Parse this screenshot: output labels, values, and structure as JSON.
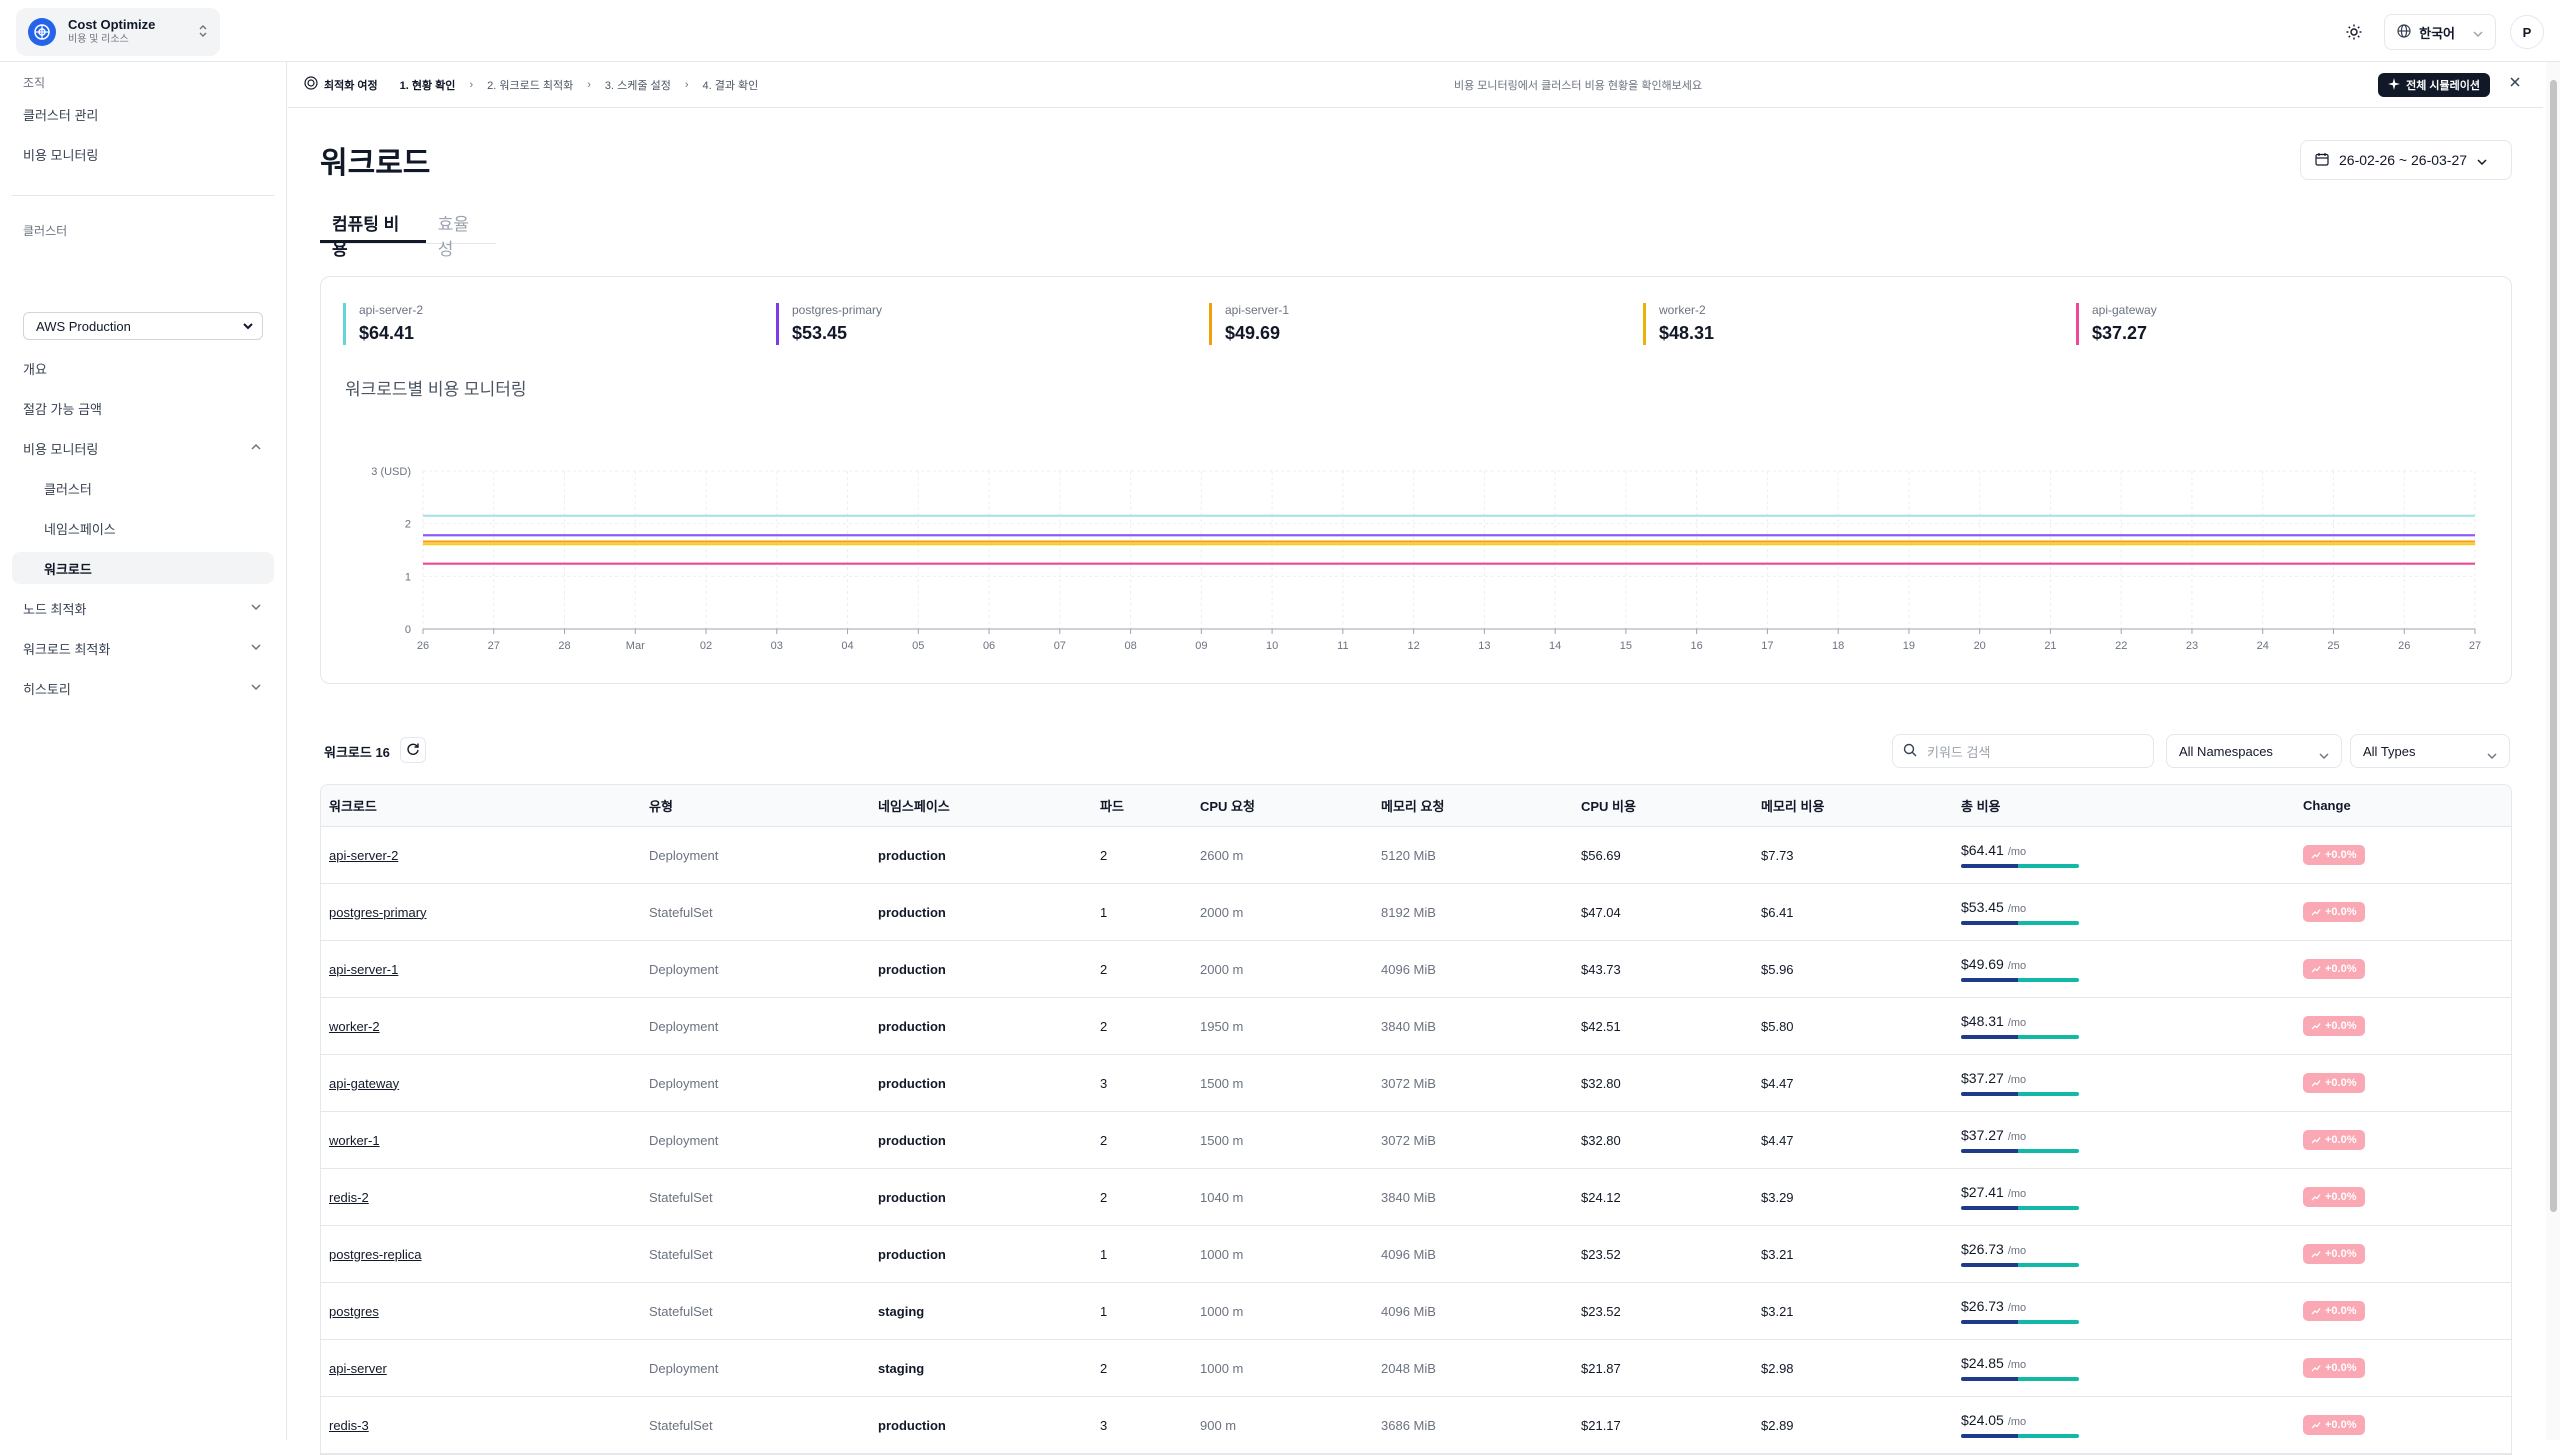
{
  "app": {
    "name": "Cost Optimize",
    "subtitle": "비용 및 리소스"
  },
  "topbar": {
    "language": "한국어",
    "avatar_initial": "P"
  },
  "sidebar": {
    "org_label": "조직",
    "org_items": [
      "클러스터 관리",
      "비용 모니터링"
    ],
    "cluster_label": "클러스터",
    "cluster_selected": "AWS Production",
    "nav": {
      "overview": "개요",
      "savings": "절감 가능 금액",
      "cost_monitoring": "비용 모니터링",
      "cost_sub": [
        "클러스터",
        "네임스페이스",
        "워크로드"
      ],
      "node_opt": "노드 최적화",
      "workload_opt": "워크로드 최적화",
      "history": "히스토리"
    }
  },
  "journey": {
    "title": "최적화 여정",
    "steps": [
      "1. 현황 확인",
      "2. 워크로드 최적화",
      "3. 스케줄 설정",
      "4. 결과 확인"
    ],
    "hint": "비용 모니터링에서 클러스터 비용 현황을 확인해보세요",
    "sim_button": "전체 시뮬레이션"
  },
  "page": {
    "title": "워크로드",
    "date_range": "26-02-26 ~ 26-03-27",
    "tabs": [
      "컴퓨팅 비용",
      "효율성"
    ]
  },
  "kpis": [
    {
      "name": "api-server-2",
      "value": "$64.41",
      "color": "#67d3dd"
    },
    {
      "name": "postgres-primary",
      "value": "$53.45",
      "color": "#7c3aed"
    },
    {
      "name": "api-server-1",
      "value": "$49.69",
      "color": "#f59e0b"
    },
    {
      "name": "worker-2",
      "value": "$48.31",
      "color": "#eab308"
    },
    {
      "name": "api-gateway",
      "value": "$37.27",
      "color": "#ec4899"
    }
  ],
  "chart_title": "워크로드별 비용 모니터링",
  "chart_data": {
    "type": "line",
    "ylabel": "3 (USD)",
    "ylim": [
      0,
      3
    ],
    "y_ticks": [
      "0",
      "1",
      "2"
    ],
    "x": [
      "26",
      "27",
      "28",
      "Mar",
      "02",
      "03",
      "04",
      "05",
      "06",
      "07",
      "08",
      "09",
      "10",
      "11",
      "12",
      "13",
      "14",
      "15",
      "16",
      "17",
      "18",
      "19",
      "20",
      "21",
      "22",
      "23",
      "24",
      "25",
      "26",
      "27"
    ],
    "series": [
      {
        "name": "api-server-2",
        "color": "#a7e3e8",
        "value": 2.15
      },
      {
        "name": "postgres-primary",
        "color": "#8b5cf6",
        "value": 1.78
      },
      {
        "name": "api-server-1",
        "color": "#f59e0b",
        "value": 1.66
      },
      {
        "name": "worker-2",
        "color": "#facc15",
        "value": 1.61
      },
      {
        "name": "api-gateway",
        "color": "#ec4899",
        "value": 1.24
      }
    ]
  },
  "table": {
    "count_label": "워크로드 16",
    "search_placeholder": "키워드 검색",
    "filter_namespace": "All Namespaces",
    "filter_type": "All Types",
    "columns": [
      "워크로드",
      "유형",
      "네임스페이스",
      "파드",
      "CPU 요청",
      "메모리 요청",
      "CPU 비용",
      "메모리 비용",
      "총 비용",
      "Change"
    ],
    "unit": "/mo",
    "rows": [
      {
        "name": "api-server-2",
        "type": "Deployment",
        "ns": "production",
        "pods": "2",
        "cpu_req": "2600 m",
        "mem_req": "5120 MiB",
        "cpu_cost": "$56.69",
        "mem_cost": "$7.73",
        "total": "$64.41",
        "change": "+0.0%"
      },
      {
        "name": "postgres-primary",
        "type": "StatefulSet",
        "ns": "production",
        "pods": "1",
        "cpu_req": "2000 m",
        "mem_req": "8192 MiB",
        "cpu_cost": "$47.04",
        "mem_cost": "$6.41",
        "total": "$53.45",
        "change": "+0.0%"
      },
      {
        "name": "api-server-1",
        "type": "Deployment",
        "ns": "production",
        "pods": "2",
        "cpu_req": "2000 m",
        "mem_req": "4096 MiB",
        "cpu_cost": "$43.73",
        "mem_cost": "$5.96",
        "total": "$49.69",
        "change": "+0.0%"
      },
      {
        "name": "worker-2",
        "type": "Deployment",
        "ns": "production",
        "pods": "2",
        "cpu_req": "1950 m",
        "mem_req": "3840 MiB",
        "cpu_cost": "$42.51",
        "mem_cost": "$5.80",
        "total": "$48.31",
        "change": "+0.0%"
      },
      {
        "name": "api-gateway",
        "type": "Deployment",
        "ns": "production",
        "pods": "3",
        "cpu_req": "1500 m",
        "mem_req": "3072 MiB",
        "cpu_cost": "$32.80",
        "mem_cost": "$4.47",
        "total": "$37.27",
        "change": "+0.0%"
      },
      {
        "name": "worker-1",
        "type": "Deployment",
        "ns": "production",
        "pods": "2",
        "cpu_req": "1500 m",
        "mem_req": "3072 MiB",
        "cpu_cost": "$32.80",
        "mem_cost": "$4.47",
        "total": "$37.27",
        "change": "+0.0%"
      },
      {
        "name": "redis-2",
        "type": "StatefulSet",
        "ns": "production",
        "pods": "2",
        "cpu_req": "1040 m",
        "mem_req": "3840 MiB",
        "cpu_cost": "$24.12",
        "mem_cost": "$3.29",
        "total": "$27.41",
        "change": "+0.0%"
      },
      {
        "name": "postgres-replica",
        "type": "StatefulSet",
        "ns": "production",
        "pods": "1",
        "cpu_req": "1000 m",
        "mem_req": "4096 MiB",
        "cpu_cost": "$23.52",
        "mem_cost": "$3.21",
        "total": "$26.73",
        "change": "+0.0%"
      },
      {
        "name": "postgres",
        "type": "StatefulSet",
        "ns": "staging",
        "pods": "1",
        "cpu_req": "1000 m",
        "mem_req": "4096 MiB",
        "cpu_cost": "$23.52",
        "mem_cost": "$3.21",
        "total": "$26.73",
        "change": "+0.0%"
      },
      {
        "name": "api-server",
        "type": "Deployment",
        "ns": "staging",
        "pods": "2",
        "cpu_req": "1000 m",
        "mem_req": "2048 MiB",
        "cpu_cost": "$21.87",
        "mem_cost": "$2.98",
        "total": "$24.85",
        "change": "+0.0%"
      },
      {
        "name": "redis-3",
        "type": "StatefulSet",
        "ns": "production",
        "pods": "3",
        "cpu_req": "900 m",
        "mem_req": "3686 MiB",
        "cpu_cost": "$21.17",
        "mem_cost": "$2.89",
        "total": "$24.05",
        "change": "+0.0%"
      }
    ]
  }
}
